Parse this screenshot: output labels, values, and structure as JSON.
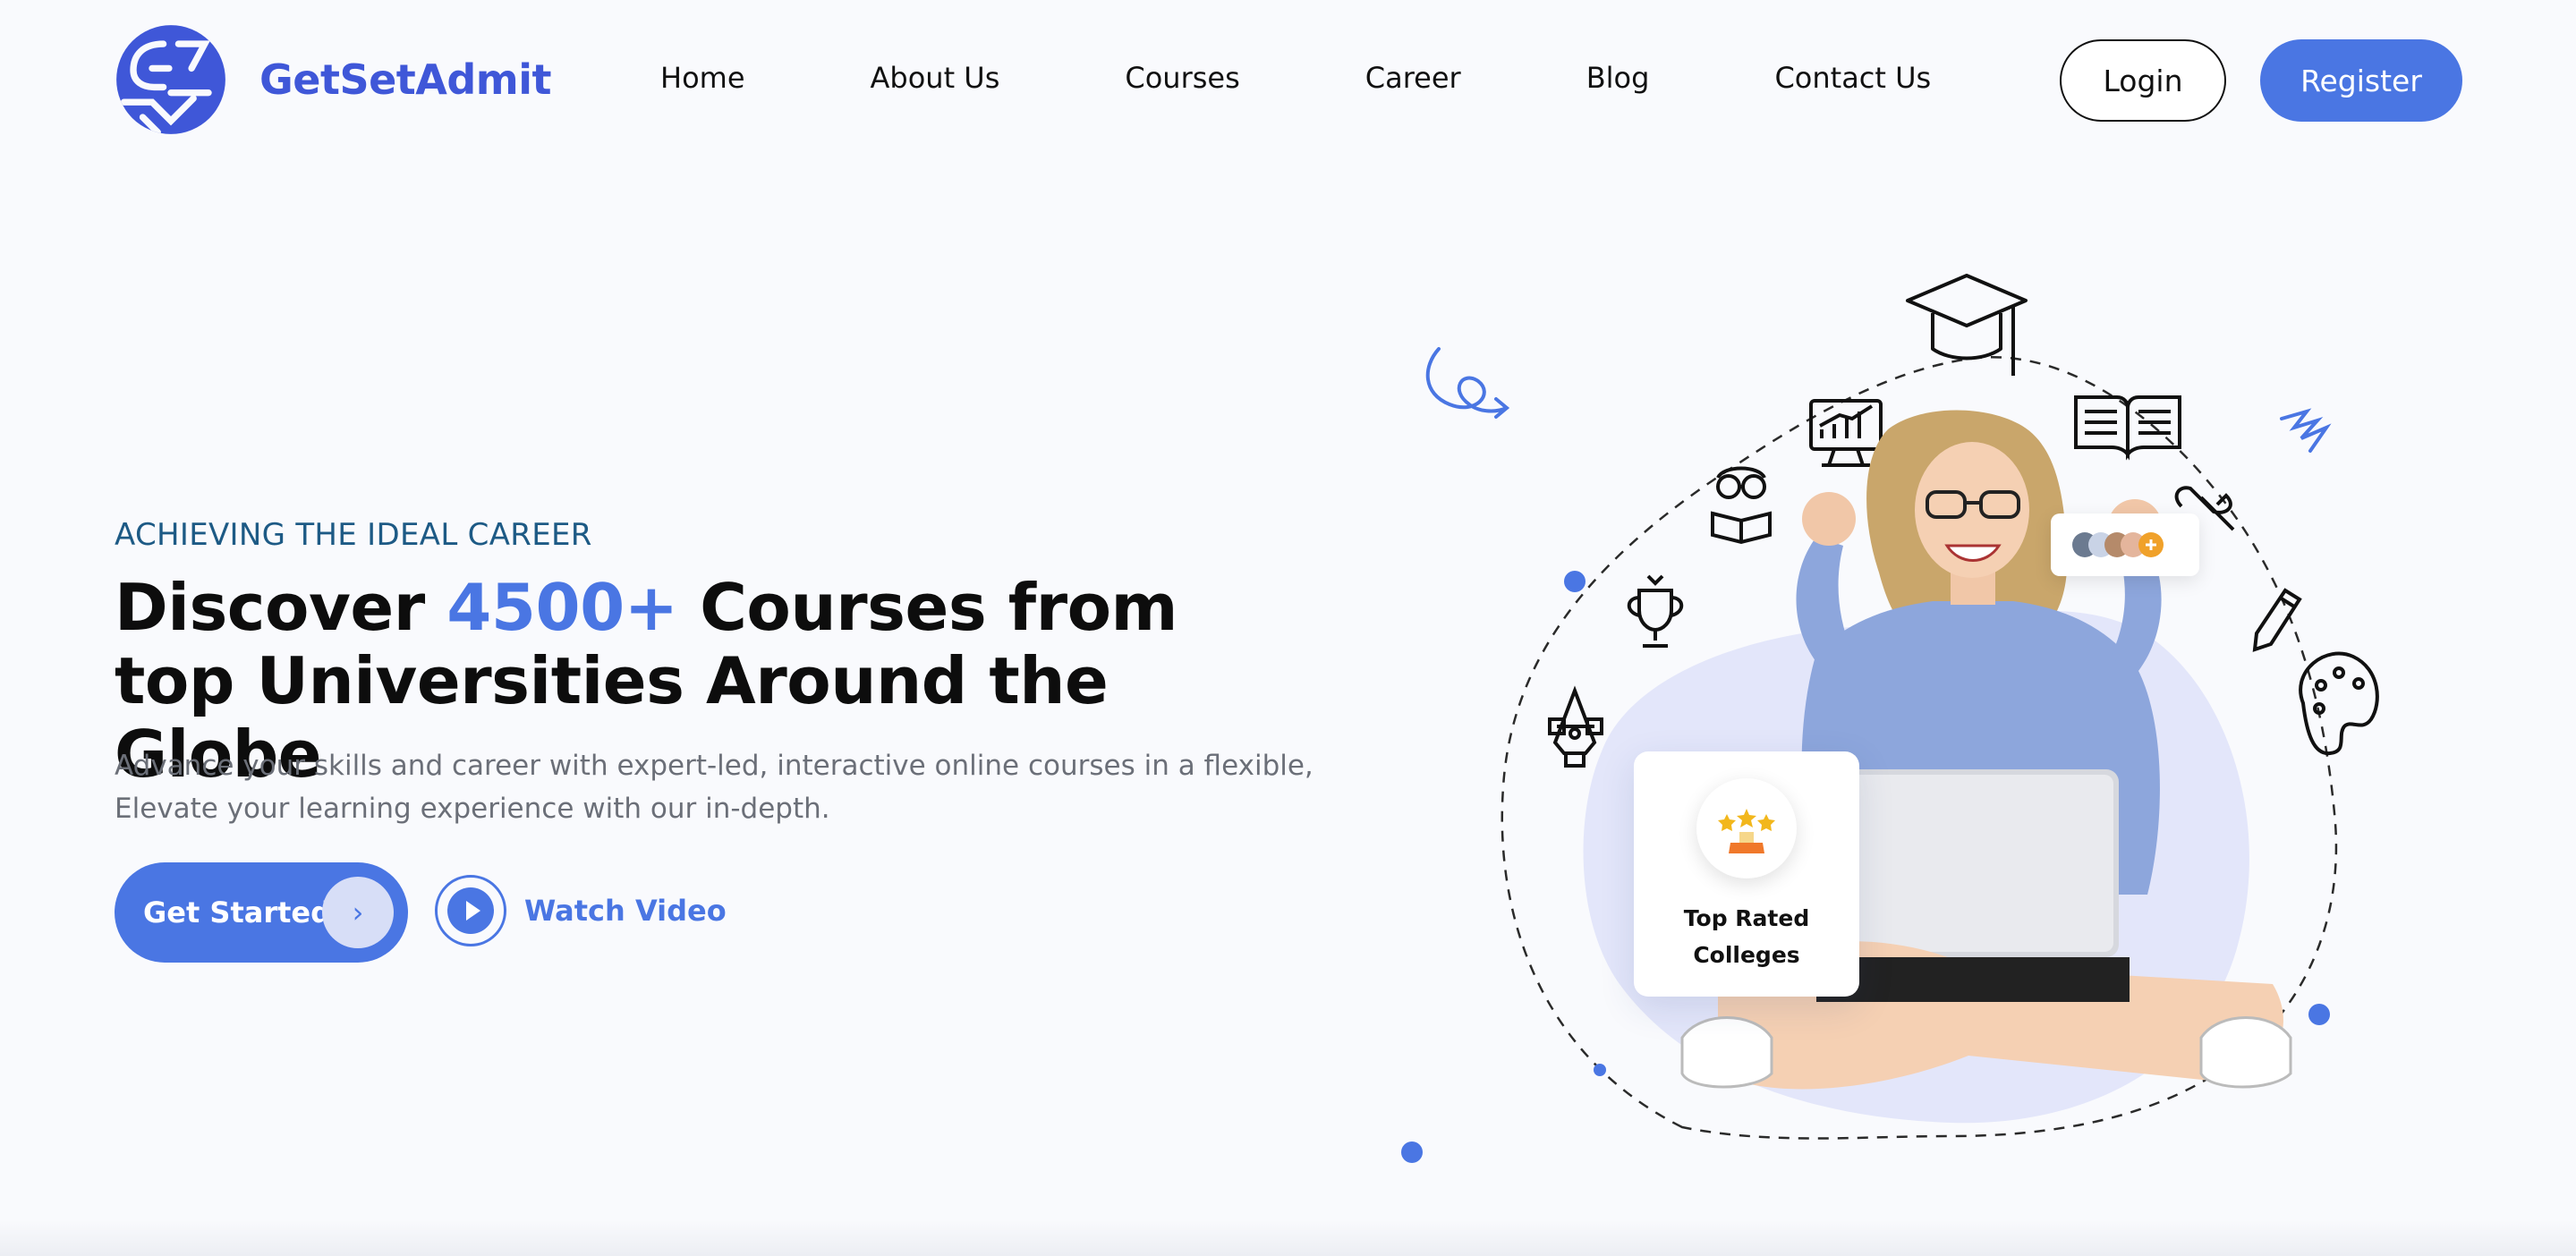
{
  "brand": {
    "name": "GetSetAdmit",
    "logo_icon": "globe-logo-icon",
    "primary_color": "#4a76e3",
    "logo_color": "#3f57d8"
  },
  "nav": {
    "links": [
      "Home",
      "About Us",
      "Courses",
      "Career",
      "Blog",
      "Contact Us"
    ],
    "login_label": "Login",
    "register_label": "Register"
  },
  "hero": {
    "eyebrow": "ACHIEVING THE IDEAL CAREER",
    "headline_part1": "Discover ",
    "headline_accent": "4500+",
    "headline_part2": " Courses from top Universities Around the Globe",
    "subtext": "Advance your skills and career with expert-led, interactive online courses in a flexible, Elevate your learning experience with our in-depth.",
    "cta_label": "Get Started",
    "cta_icon": "chevron-right-icon",
    "video_label": "Watch Video",
    "video_icon": "play-icon"
  },
  "illustration": {
    "card_label": "Top Rated Colleges",
    "card_icon": "star-award-icon",
    "orbit_icons": [
      "pen-tool-icon",
      "trophy-icon",
      "reading-icon",
      "chart-monitor-icon",
      "graduation-cap-icon",
      "open-book-icon",
      "wrench-icon",
      "pencil-icon",
      "palette-icon"
    ],
    "avatar_group_icon": "avatar-group-icon",
    "accent_dot_color": "#4a76e3",
    "blob_color": "#e3e6fa"
  }
}
